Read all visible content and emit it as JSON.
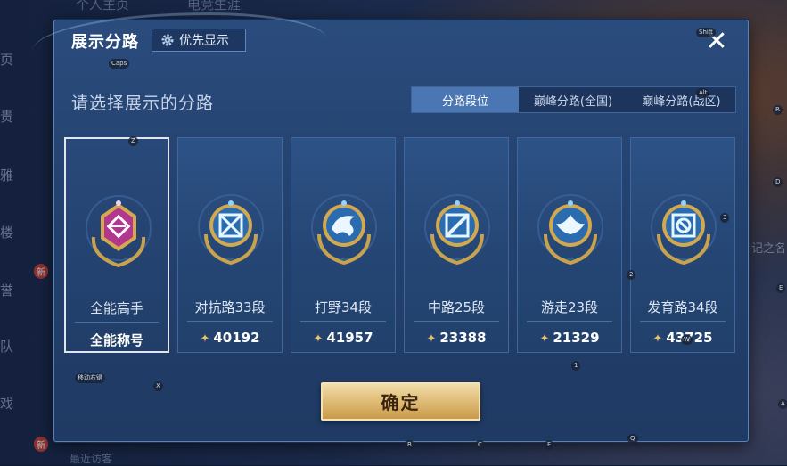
{
  "background": {
    "left_items": [
      "页",
      "贵",
      "雅",
      "楼",
      "誉",
      "队",
      "戏"
    ],
    "top_items": [
      "个人主页",
      "电竞生涯"
    ],
    "right_text": "记之名",
    "new_badge": "新",
    "bottom_text": "最近访客"
  },
  "dialog": {
    "title": "展示分路",
    "priority_button": "优先显示",
    "subtitle": "请选择展示的分路",
    "tabs": [
      {
        "label": "分路段位",
        "active": true
      },
      {
        "label": "巅峰分路(全国)",
        "active": false
      },
      {
        "label": "巅峰分路(战区)",
        "active": false
      }
    ],
    "cards": [
      {
        "name": "全能高手",
        "value": "全能称号",
        "selected": true,
        "emblem": "all-round-emblem-icon",
        "show_score_icon": false
      },
      {
        "name": "对抗路33段",
        "value": "40192",
        "selected": false,
        "emblem": "clash-lane-emblem-icon",
        "show_score_icon": true
      },
      {
        "name": "打野34段",
        "value": "41957",
        "selected": false,
        "emblem": "jungle-emblem-icon",
        "show_score_icon": true
      },
      {
        "name": "中路25段",
        "value": "23388",
        "selected": false,
        "emblem": "mid-lane-emblem-icon",
        "show_score_icon": true
      },
      {
        "name": "游走23段",
        "value": "21329",
        "selected": false,
        "emblem": "roam-emblem-icon",
        "show_score_icon": true
      },
      {
        "name": "发育路34段",
        "value": "43725",
        "selected": false,
        "emblem": "farm-lane-emblem-icon",
        "show_score_icon": true
      }
    ],
    "confirm": "确定"
  },
  "key_hints": [
    "Caps",
    "Shift",
    "Alt",
    "R",
    "D",
    "E",
    "Z",
    "X",
    "A",
    "B",
    "C",
    "F",
    "Q",
    "1",
    "2",
    "3",
    "W",
    "移动右键"
  ],
  "colors": {
    "accent_gold": "#e1bf7a",
    "selected_emblem": "#b3368f",
    "tab_active": "#4a76b4"
  }
}
